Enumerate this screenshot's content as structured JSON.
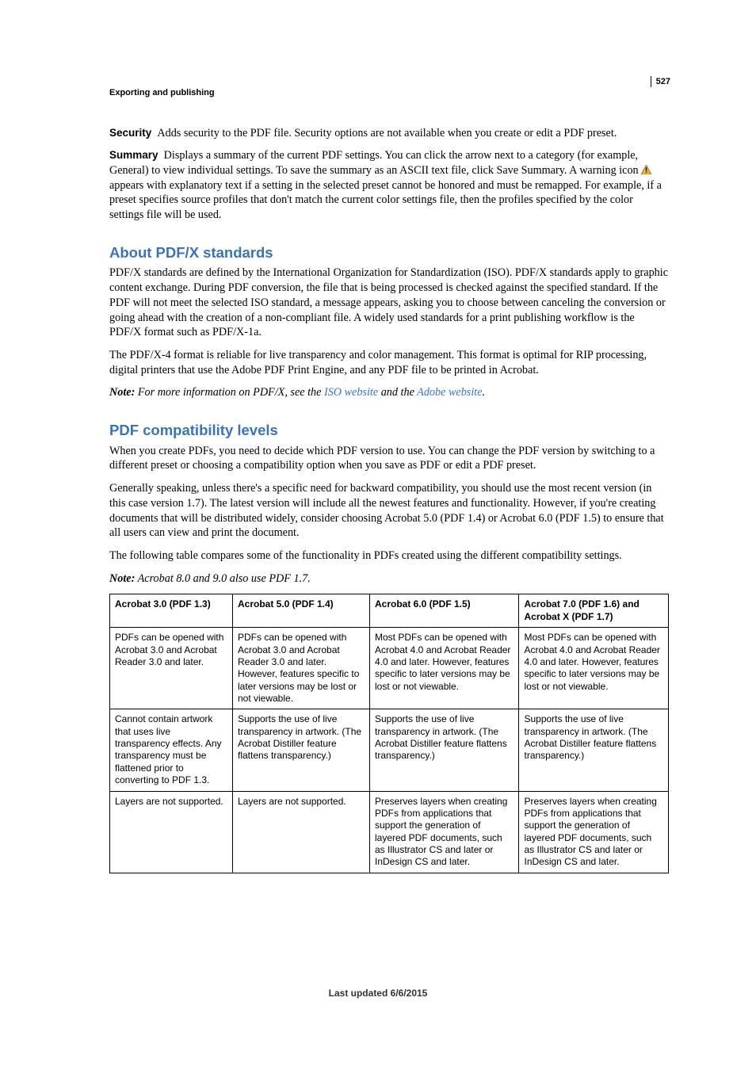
{
  "page_number": "527",
  "breadcrumb": "Exporting and publishing",
  "blocks": {
    "security": {
      "label": "Security",
      "text": "Adds security to the PDF file. Security options are not available when you create or edit a PDF preset."
    },
    "summary": {
      "label": "Summary",
      "text_before_icon": "Displays a summary of the current PDF settings. You can click the arrow next to a category (for example, General) to view individual settings. To save the summary as an ASCII text file, click Save Summary. A warning icon ",
      "text_after_icon": "appears with explanatory text if a setting in the selected preset cannot be honored and must be remapped. For example, if a preset specifies source profiles that don't match the current color settings file, then the profiles specified by the color settings file will be used."
    }
  },
  "sections": {
    "pdfx": {
      "heading": "About PDF/X standards",
      "p1": "PDF/X standards are defined by the International Organization for Standardization (ISO). PDF/X standards apply to graphic content exchange. During PDF conversion, the file that is being processed is checked against the specified standard. If the PDF will not meet the selected ISO standard, a message appears, asking you to choose between canceling the conversion or going ahead with the creation of a non-compliant file. A widely used standards for a print publishing workflow is the PDF/X format such as PDF/X-1a.",
      "p2": "The PDF/X-4 format is reliable for live transparency and color management. This format is optimal for RIP processing, digital printers that use the Adobe PDF Print Engine, and any PDF file to be printed in Acrobat.",
      "note_label": "Note:",
      "note_prefix": " For more information on PDF/X, see the ",
      "note_link1": "ISO website",
      "note_mid": " and the ",
      "note_link2": "Adobe website",
      "note_suffix": "."
    },
    "compat": {
      "heading": "PDF compatibility levels",
      "p1": "When you create PDFs, you need to decide which PDF version to use. You can change the PDF version by switching to a different preset or choosing a compatibility option when you save as PDF or edit a PDF preset.",
      "p2": "Generally speaking, unless there's a specific need for backward compatibility, you should use the most recent version (in this case version 1.7). The latest version will include all the newest features and functionality. However, if you're creating documents that will be distributed widely, consider choosing Acrobat 5.0 (PDF 1.4) or Acrobat 6.0 (PDF 1.5) to ensure that all users can view and print the document.",
      "p3": "The following table compares some of the functionality in PDFs created using the different compatibility settings.",
      "note_label": "Note:",
      "note_text": " Acrobat 8.0 and 9.0 also use PDF 1.7."
    }
  },
  "table": {
    "headers": [
      "Acrobat 3.0 (PDF 1.3)",
      "Acrobat 5.0 (PDF 1.4)",
      "Acrobat 6.0 (PDF 1.5)",
      "Acrobat 7.0 (PDF 1.6) and Acrobat X (PDF 1.7)"
    ],
    "rows": [
      [
        "PDFs can be opened with Acrobat 3.0 and Acrobat Reader 3.0 and later.",
        "PDFs can be opened with Acrobat 3.0 and Acrobat Reader 3.0 and later. However, features specific to later versions may be lost or not viewable.",
        "Most PDFs can be opened with Acrobat 4.0 and Acrobat Reader 4.0 and later. However, features specific to later versions may be lost or not viewable.",
        "Most PDFs can be opened with Acrobat 4.0 and Acrobat Reader 4.0 and later. However, features specific to later versions may be lost or not viewable."
      ],
      [
        "Cannot contain artwork that uses live transparency effects. Any transparency must be flattened prior to converting to PDF 1.3.",
        "Supports the use of live transparency in artwork. (The Acrobat Distiller feature flattens transparency.)",
        "Supports the use of live transparency in artwork. (The Acrobat Distiller feature flattens transparency.)",
        "Supports the use of live transparency in artwork. (The Acrobat Distiller feature flattens transparency.)"
      ],
      [
        "Layers are not supported.",
        "Layers are not supported.",
        "Preserves layers when creating PDFs from applications that support the generation of layered PDF documents, such as Illustrator CS and later or InDesign CS and later.",
        "Preserves layers when creating PDFs from applications that support the generation of layered PDF documents, such as Illustrator CS and later or InDesign CS and later."
      ]
    ]
  },
  "footer": "Last updated 6/6/2015"
}
